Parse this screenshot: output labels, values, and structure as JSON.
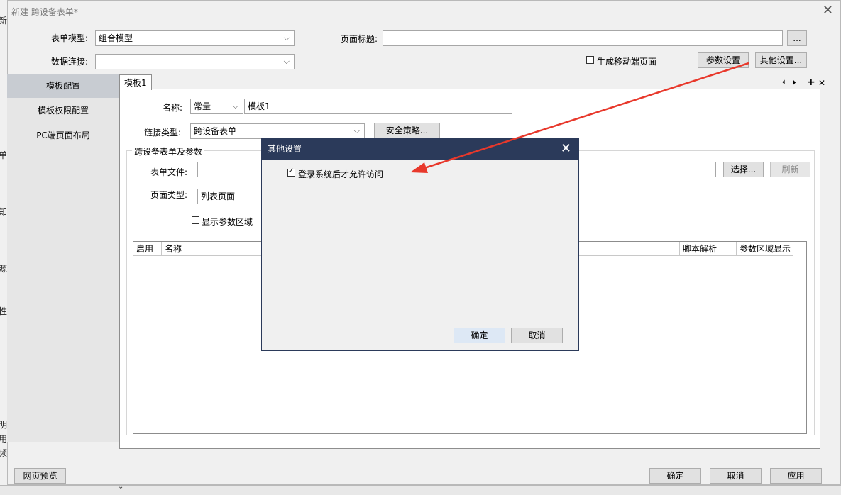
{
  "background_fragments": {
    "chars": [
      "新",
      "单",
      "知",
      "源",
      "性",
      "明",
      "用",
      "频"
    ],
    "bottom_glyph": "⌄"
  },
  "drift": 0.8,
  "window": {
    "title": "新建 跨设备表单*",
    "close_icon": "close-icon"
  },
  "form": {
    "model_label": "表单模型:",
    "model_value": "组合模型",
    "data_label": "数据连接:",
    "data_value": "",
    "page_title_label": "页面标题:",
    "page_title_value": "",
    "ellipsis": "...",
    "mobile_check_label": "生成移动端页面",
    "mobile_checked": false,
    "param_button": "参数设置",
    "other_button": "其他设置..."
  },
  "nav": {
    "items": [
      {
        "label": "模板配置",
        "active": true
      },
      {
        "label": "模板权限配置",
        "active": false
      },
      {
        "label": "PC端页面布局",
        "active": false
      }
    ]
  },
  "tab": {
    "label": "模板1",
    "prev_icon": "⏴",
    "next_icon": "⏵",
    "add_icon": "+",
    "remove_icon": "✕"
  },
  "template": {
    "name_label": "名称:",
    "name_type": "常量",
    "name_value": "模板1",
    "link_type_label": "链接类型:",
    "link_type_value": "跨设备表单",
    "security_button": "安全策略...",
    "group_label": "跨设备表单及参数",
    "form_file_label": "表单文件:",
    "form_file_value": "",
    "select_button": "选择...",
    "refresh_button": "刷新",
    "page_type_label": "页面类型:",
    "page_type_value": "列表页面",
    "show_param_label": "显示参数区域",
    "show_param_checked": false,
    "columns": [
      "启用",
      "名称",
      "脚本解析",
      "参数区域显示"
    ]
  },
  "overlay": {
    "title": "其他设置",
    "login_check_label": "登录系统后才允许访问",
    "login_checked": true,
    "ok": "确定",
    "cancel": "取消"
  },
  "footer": {
    "preview": "网页预览",
    "ok": "确定",
    "cancel": "取消",
    "apply": "应用"
  },
  "colors": {
    "arrow": "#e8382b",
    "overlay_title_bg": "#2b3a5a"
  }
}
